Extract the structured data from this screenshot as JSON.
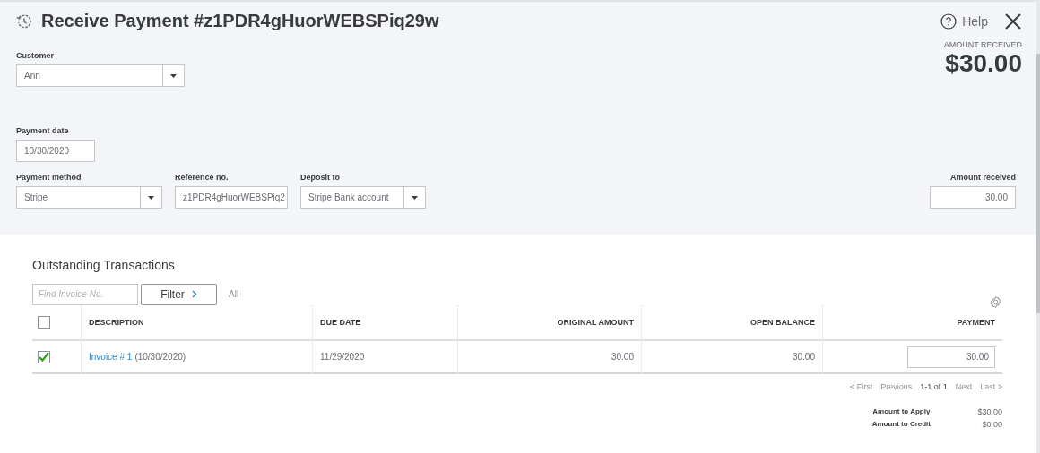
{
  "header": {
    "title": "Receive Payment #z1PDR4gHuorWEBSPiq29w",
    "help": "Help"
  },
  "amount_summary": {
    "label": "AMOUNT RECEIVED",
    "value": "$30.00"
  },
  "customer": {
    "label": "Customer",
    "value": "Ann"
  },
  "payment_date": {
    "label": "Payment date",
    "value": "10/30/2020"
  },
  "payment_method": {
    "label": "Payment method",
    "value": "Stripe"
  },
  "reference": {
    "label": "Reference no.",
    "value": "z1PDR4gHuorWEBSPiq2"
  },
  "deposit_to": {
    "label": "Deposit to",
    "value": "Stripe Bank account"
  },
  "amount_received": {
    "label": "Amount received",
    "value": "30.00"
  },
  "outstanding": {
    "title": "Outstanding Transactions",
    "search": {
      "placeholder": "Find Invoice No."
    },
    "filter": "Filter",
    "filter_value": "All",
    "select_all": {
      "checked": false
    },
    "columns": [
      "DESCRIPTION",
      "DUE DATE",
      "ORIGINAL AMOUNT",
      "OPEN BALANCE",
      "PAYMENT"
    ],
    "rows": [
      {
        "checked": true,
        "link": "Invoice # 1",
        "description": "(10/30/2020)",
        "due_date": "11/29/2020",
        "original_amount": "30.00",
        "open_balance": "30.00",
        "payment": "30.00"
      }
    ],
    "pagination": [
      {
        "label": "< First",
        "disabled": true
      },
      {
        "label": "Previous",
        "disabled": true
      },
      {
        "label": "1-1 of 1",
        "disabled": false
      },
      {
        "label": "Next",
        "disabled": true
      },
      {
        "label": "Last >",
        "disabled": true
      }
    ]
  },
  "totals": [
    {
      "label": "Amount to Apply",
      "value": "$30.00"
    },
    {
      "label": "Amount to Credit",
      "value": "$0.00"
    }
  ]
}
